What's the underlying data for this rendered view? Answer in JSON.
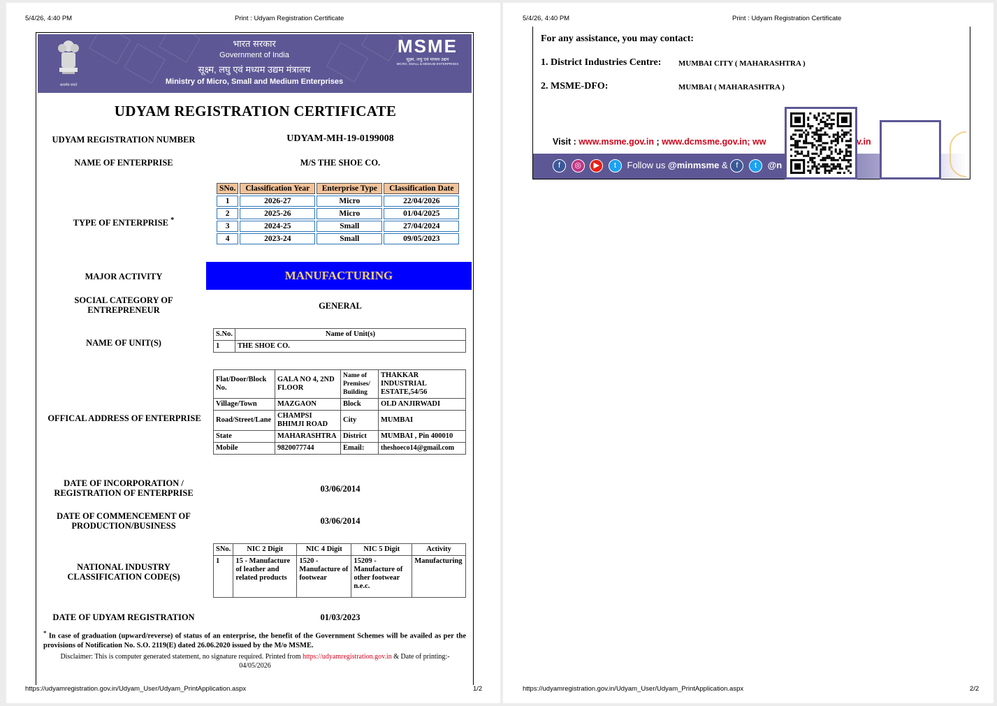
{
  "print_header": {
    "datetime": "5/4/26, 4:40 PM",
    "title": "Print : Udyam Registration Certificate"
  },
  "print_footer": {
    "url": "https://udyamregistration.gov.in/Udyam_User/Udyam_PrintApplication.aspx",
    "page1": "1/2",
    "page2": "2/2"
  },
  "banner": {
    "line1": "भारत सरकार",
    "line2": "Government of India",
    "line3": "सूक्ष्म, लघु एवं मध्यम उद्यम मंत्रालय",
    "line4": "Ministry of Micro, Small and Medium Enterprises",
    "logo_text": "MSME",
    "logo_sub1": "सूक्ष्म, लघु एवं मध्यम उद्यम",
    "logo_sub2": "MICRO, SMALL & MEDIUM ENTERPRISES",
    "emblem_caption": "सत्यमेव जयते"
  },
  "certificate": {
    "title": "UDYAM REGISTRATION CERTIFICATE",
    "reg_no_label": "UDYAM REGISTRATION NUMBER",
    "reg_no": "UDYAM-MH-19-0199008",
    "name_label": "NAME OF ENTERPRISE",
    "name": "M/S THE SHOE CO.",
    "type_label": "TYPE OF ENTERPRISE",
    "type_star": "*",
    "classification": {
      "headers": [
        "SNo.",
        "Classification Year",
        "Enterprise Type",
        "Classification Date"
      ],
      "rows": [
        [
          "1",
          "2026-27",
          "Micro",
          "22/04/2026"
        ],
        [
          "2",
          "2025-26",
          "Micro",
          "01/04/2025"
        ],
        [
          "3",
          "2024-25",
          "Small",
          "27/04/2024"
        ],
        [
          "4",
          "2023-24",
          "Small",
          "09/05/2023"
        ]
      ]
    },
    "major_activity_label": "MAJOR ACTIVITY",
    "major_activity": "MANUFACTURING",
    "social_label_1": "SOCIAL CATEGORY OF",
    "social_label_2": "ENTREPRENEUR",
    "social_value": "GENERAL",
    "units_label": "NAME OF UNIT(S)",
    "units": {
      "headers": [
        "S.No.",
        "Name of Unit(s)"
      ],
      "rows": [
        [
          "1",
          "THE SHOE CO."
        ]
      ]
    },
    "address_label": "OFFICAL ADDRESS OF ENTERPRISE",
    "address": {
      "flat_label": "Flat/Door/Block No.",
      "flat": "GALA NO 4, 2ND FLOOR",
      "premises_label": "Name of Premises/ Building",
      "premises": "THAKKAR INDUSTRIAL ESTATE,54/56",
      "village_label": "Village/Town",
      "village": "MAZGAON",
      "block_label": "Block",
      "block": "OLD ANJIRWADI",
      "road_label": "Road/Street/Lane",
      "road": "CHAMPSI BHIMJI ROAD",
      "city_label": "City",
      "city": "MUMBAI",
      "state_label": "State",
      "state": "MAHARASHTRA",
      "district_label": "District",
      "district": "MUMBAI , Pin 400010",
      "mobile_label": "Mobile",
      "mobile": "9820077744",
      "email_label": "Email:",
      "email": "theshoeco14@gmail.com"
    },
    "incorp_label_1": "DATE OF INCORPORATION /",
    "incorp_label_2": "REGISTRATION OF ENTERPRISE",
    "incorp_date": "03/06/2014",
    "commence_label_1": "DATE OF COMMENCEMENT OF",
    "commence_label_2": "PRODUCTION/BUSINESS",
    "commence_date": "03/06/2014",
    "nic_label_1": "NATIONAL INDUSTRY",
    "nic_label_2": "CLASSIFICATION CODE(S)",
    "nic": {
      "headers": [
        "SNo.",
        "NIC 2 Digit",
        "NIC 4 Digit",
        "NIC 5 Digit",
        "Activity"
      ],
      "rows": [
        [
          "1",
          "15 - Manufacture of leather and related products",
          "1520 - Manufacture of footwear",
          "15209 - Manufacture of other footwear n.e.c.",
          "Manufacturing"
        ]
      ]
    },
    "udyam_date_label": "DATE OF UDYAM REGISTRATION",
    "udyam_date": "01/03/2023",
    "footnote_star": "*",
    "footnote": "In case of graduation (upward/reverse) of status of an enterprise, the benefit of the Government Schemes will be availed as per the provisions of Notification No. S.O. 2119(E) dated 26.06.2020 issued by the M/o MSME.",
    "disclaimer_a": "Disclaimer: This is computer generated statement, no signature required. Printed from",
    "disclaimer_link": "https://udyamregistration.gov.in",
    "disclaimer_b": "& Date of printing:-",
    "print_date": "04/05/2026"
  },
  "page2": {
    "assist": "For any assistance, you may contact:",
    "dic_label": "1. District Industries Centre:",
    "dic_value": "MUMBAI CITY ( MAHARASHTRA )",
    "dfo_label": "2. MSME-DFO:",
    "dfo_value": "MUMBAI ( MAHARASHTRA )",
    "visit_label": "Visit :",
    "visit_link1": "www.msme.gov.in",
    "visit_sep": ";",
    "visit_link2": "www.dcmsme.gov.in",
    "visit_sep2": "; ww",
    "visit_tail": "v.in",
    "follow_text": "Follow us",
    "follow_handle": "@minmsme",
    "follow_amp": "&",
    "follow_tail": "@n"
  },
  "colors": {
    "banner": "#5d5895",
    "activity_bg": "#0000ff",
    "activity_text": "#f5d36b",
    "header_cell": "#f2c39a",
    "link_red": "#d0021b"
  }
}
